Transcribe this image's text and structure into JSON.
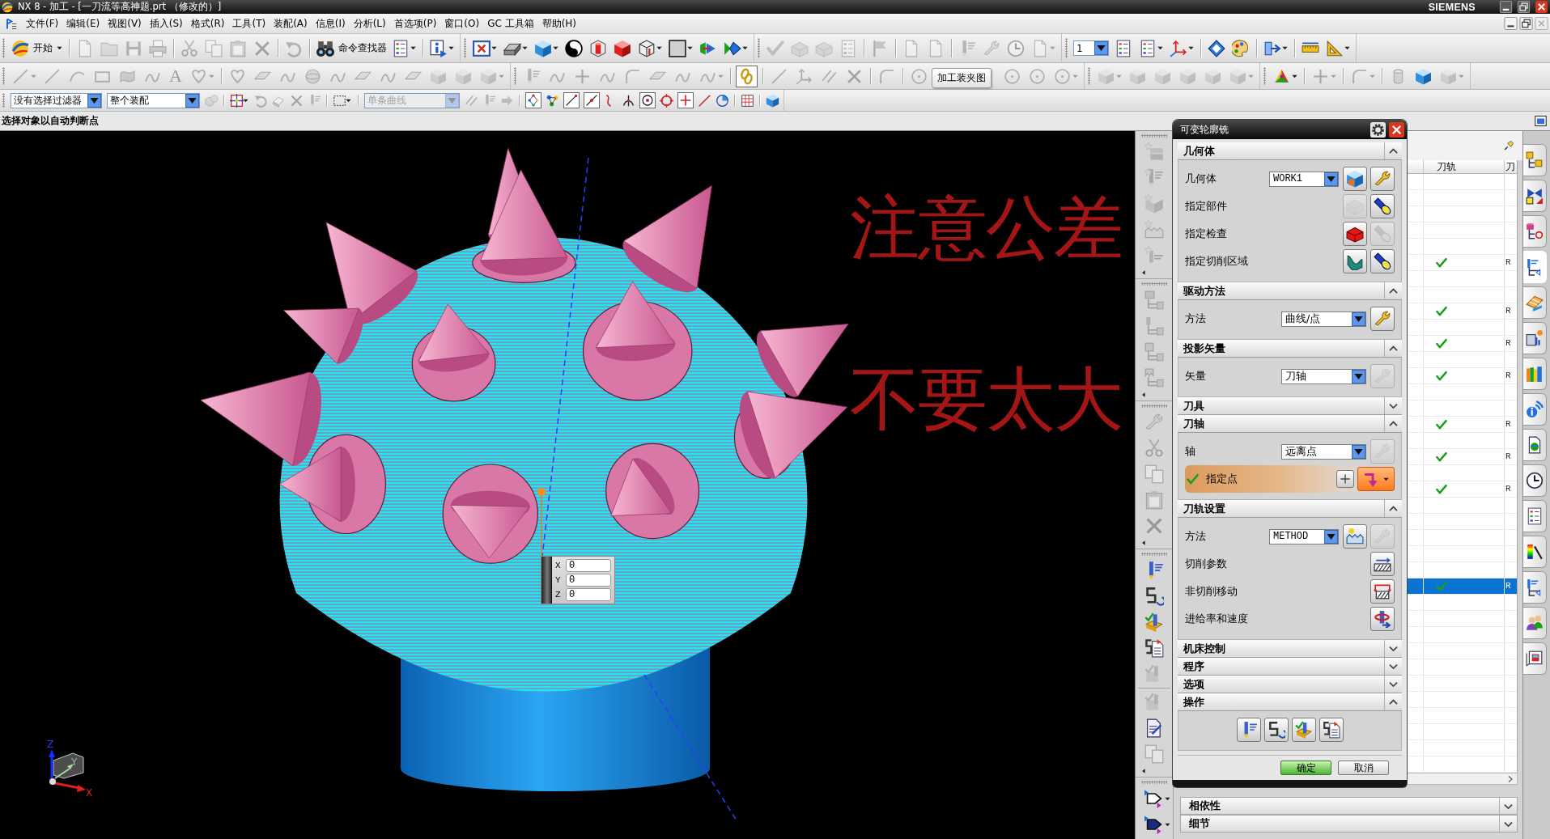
{
  "window": {
    "title": "NX 8 - 加工 - [一刀流等高神题.prt （修改的）]",
    "brand": "SIEMENS"
  },
  "menu": [
    "文件(F)",
    "编辑(E)",
    "视图(V)",
    "插入(S)",
    "格式(R)",
    "工具(T)",
    "装配(A)",
    "信息(I)",
    "分析(L)",
    "首选项(P)",
    "窗口(O)",
    "GC 工具箱",
    "帮助(H)"
  ],
  "toolbar_rows": [
    [
      [
        [
          {
            "kind": "labeled",
            "label": "开始",
            "disabled": false,
            "dropdown": true
          }
        ],
        [
          {
            "kind": "icon",
            "disabled": true,
            "dropdown": false,
            "on": false
          },
          {
            "kind": "icon",
            "disabled": true,
            "dropdown": false,
            "on": false
          },
          {
            "kind": "icon",
            "disabled": true,
            "dropdown": false,
            "on": false
          },
          {
            "kind": "icon",
            "disabled": true,
            "dropdown": false,
            "on": false
          }
        ],
        [
          {
            "kind": "icon",
            "disabled": true,
            "dropdown": false,
            "on": false
          },
          {
            "kind": "icon",
            "disabled": true,
            "dropdown": false,
            "on": false
          },
          {
            "kind": "icon",
            "disabled": true,
            "dropdown": false,
            "on": false
          },
          {
            "kind": "icon",
            "disabled": true,
            "dropdown": false,
            "on": false
          }
        ],
        [
          {
            "kind": "icon",
            "disabled": true,
            "dropdown": false,
            "on": false
          }
        ],
        [
          {
            "kind": "labeled",
            "label": "命令查找器",
            "disabled": false,
            "dropdown": false
          },
          {
            "kind": "icon",
            "disabled": false,
            "dropdown": true,
            "on": false
          }
        ],
        [
          {
            "kind": "icon",
            "disabled": false,
            "dropdown": true,
            "on": false
          }
        ]
      ],
      [
        [
          {
            "kind": "icon",
            "disabled": false,
            "dropdown": true,
            "on": false
          },
          {
            "kind": "icon",
            "disabled": false,
            "dropdown": true,
            "on": false
          },
          {
            "kind": "icon",
            "disabled": false,
            "dropdown": true,
            "on": false
          },
          {
            "kind": "icon",
            "disabled": false,
            "dropdown": false,
            "on": false
          },
          {
            "kind": "icon",
            "disabled": false,
            "dropdown": false,
            "on": false
          },
          {
            "kind": "icon",
            "disabled": false,
            "dropdown": false,
            "on": false
          },
          {
            "kind": "icon",
            "disabled": false,
            "dropdown": true,
            "on": false
          },
          {
            "kind": "icon",
            "disabled": false,
            "dropdown": true,
            "on": false
          },
          {
            "kind": "icon",
            "disabled": false,
            "dropdown": false,
            "on": false
          },
          {
            "kind": "icon",
            "disabled": false,
            "dropdown": true,
            "on": false
          }
        ]
      ],
      [
        [
          {
            "kind": "icon",
            "disabled": true,
            "dropdown": false,
            "on": false
          },
          {
            "kind": "icon",
            "disabled": true,
            "dropdown": false,
            "on": false
          },
          {
            "kind": "icon",
            "disabled": true,
            "dropdown": false,
            "on": false
          },
          {
            "kind": "icon",
            "disabled": true,
            "dropdown": false,
            "on": false
          }
        ],
        [
          {
            "kind": "icon",
            "disabled": true,
            "dropdown": false,
            "on": false
          }
        ],
        [
          {
            "kind": "icon",
            "disabled": true,
            "dropdown": false,
            "on": false
          },
          {
            "kind": "icon",
            "disabled": true,
            "dropdown": false,
            "on": false
          }
        ],
        [
          {
            "kind": "icon",
            "disabled": true,
            "dropdown": false,
            "on": false
          },
          {
            "kind": "icon",
            "disabled": true,
            "dropdown": false,
            "on": false
          },
          {
            "kind": "icon",
            "disabled": true,
            "dropdown": false,
            "on": false
          },
          {
            "kind": "icon",
            "disabled": true,
            "dropdown": true,
            "on": false
          }
        ]
      ],
      [
        [
          {
            "kind": "combo",
            "value": "1",
            "disabled": false
          },
          {
            "kind": "icon",
            "disabled": false,
            "dropdown": false,
            "on": false
          },
          {
            "kind": "icon",
            "disabled": false,
            "dropdown": true,
            "on": false
          },
          {
            "kind": "icon",
            "disabled": false,
            "dropdown": true,
            "on": false
          }
        ],
        [
          {
            "kind": "icon",
            "disabled": false,
            "dropdown": false,
            "on": false
          },
          {
            "kind": "icon",
            "disabled": false,
            "dropdown": false,
            "on": false
          }
        ],
        [
          {
            "kind": "icon",
            "disabled": false,
            "dropdown": true,
            "on": false
          }
        ],
        [
          {
            "kind": "icon",
            "disabled": false,
            "dropdown": false,
            "on": false
          },
          {
            "kind": "icon",
            "disabled": false,
            "dropdown": true,
            "on": false
          }
        ]
      ]
    ],
    [
      [
        [
          {
            "kind": "icon",
            "disabled": true,
            "dropdown": true,
            "on": false
          },
          {
            "kind": "icon",
            "disabled": true,
            "dropdown": false,
            "on": false
          },
          {
            "kind": "icon",
            "disabled": true,
            "dropdown": false,
            "on": false
          },
          {
            "kind": "icon",
            "disabled": true,
            "dropdown": false,
            "on": false
          },
          {
            "kind": "icon",
            "disabled": true,
            "dropdown": false,
            "on": false
          },
          {
            "kind": "icon",
            "disabled": true,
            "dropdown": false,
            "on": false
          },
          {
            "kind": "glyph",
            "text": "A",
            "disabled": true,
            "dropdown": false
          },
          {
            "kind": "icon",
            "disabled": true,
            "dropdown": true,
            "on": false
          }
        ],
        [
          {
            "kind": "icon",
            "disabled": true,
            "dropdown": false,
            "on": false
          },
          {
            "kind": "icon",
            "disabled": true,
            "dropdown": false,
            "on": false
          },
          {
            "kind": "icon",
            "disabled": true,
            "dropdown": false,
            "on": false
          },
          {
            "kind": "icon",
            "disabled": true,
            "dropdown": false,
            "on": false
          },
          {
            "kind": "icon",
            "disabled": true,
            "dropdown": false,
            "on": false
          },
          {
            "kind": "icon",
            "disabled": true,
            "dropdown": false,
            "on": false
          },
          {
            "kind": "icon",
            "disabled": true,
            "dropdown": false,
            "on": false
          },
          {
            "kind": "icon",
            "disabled": true,
            "dropdown": false,
            "on": false
          },
          {
            "kind": "icon",
            "disabled": true,
            "dropdown": false,
            "on": false
          },
          {
            "kind": "icon",
            "disabled": true,
            "dropdown": false,
            "on": false
          },
          {
            "kind": "icon",
            "disabled": true,
            "dropdown": true,
            "on": false
          }
        ]
      ],
      [
        [
          {
            "kind": "icon",
            "disabled": true,
            "dropdown": false,
            "on": false
          },
          {
            "kind": "icon",
            "disabled": true,
            "dropdown": false,
            "on": false
          },
          {
            "kind": "icon",
            "disabled": true,
            "dropdown": false,
            "on": false
          },
          {
            "kind": "icon",
            "disabled": true,
            "dropdown": false,
            "on": false
          },
          {
            "kind": "icon",
            "disabled": true,
            "dropdown": false,
            "on": false
          },
          {
            "kind": "icon",
            "disabled": true,
            "dropdown": false,
            "on": false
          },
          {
            "kind": "icon",
            "disabled": true,
            "dropdown": false,
            "on": false
          },
          {
            "kind": "icon",
            "disabled": true,
            "dropdown": true,
            "on": false
          }
        ],
        [
          {
            "kind": "icon",
            "disabled": false,
            "dropdown": false,
            "on": true
          }
        ],
        [
          {
            "kind": "icon",
            "disabled": true,
            "dropdown": false,
            "on": false
          },
          {
            "kind": "icon",
            "disabled": true,
            "dropdown": false,
            "on": false
          },
          {
            "kind": "icon",
            "disabled": true,
            "dropdown": false,
            "on": false
          },
          {
            "kind": "icon",
            "disabled": true,
            "dropdown": false,
            "on": false
          }
        ],
        [
          {
            "kind": "icon",
            "disabled": true,
            "dropdown": false,
            "on": false
          }
        ],
        [
          {
            "kind": "icon",
            "disabled": true,
            "dropdown": false,
            "on": false
          },
          {
            "kind": "icon",
            "disabled": true,
            "dropdown": false,
            "on": false
          },
          {
            "kind": "icon",
            "disabled": true,
            "dropdown": false,
            "on": false
          },
          {
            "kind": "icon",
            "disabled": true,
            "dropdown": true,
            "on": false
          }
        ]
      ],
      [
        [
          {
            "kind": "icon",
            "disabled": true,
            "dropdown": true,
            "on": false
          },
          {
            "kind": "icon",
            "disabled": true,
            "dropdown": false,
            "on": false
          },
          {
            "kind": "icon",
            "disabled": true,
            "dropdown": false,
            "on": false
          },
          {
            "kind": "icon",
            "disabled": true,
            "dropdown": false,
            "on": false
          },
          {
            "kind": "icon",
            "disabled": true,
            "dropdown": false,
            "on": false
          },
          {
            "kind": "icon",
            "disabled": true,
            "dropdown": true,
            "on": false
          }
        ]
      ],
      [
        [
          {
            "kind": "icon",
            "disabled": false,
            "dropdown": true,
            "on": false
          }
        ],
        [
          {
            "kind": "icon",
            "disabled": true,
            "dropdown": true,
            "on": false
          }
        ],
        [
          {
            "kind": "icon",
            "disabled": true,
            "dropdown": true,
            "on": false
          }
        ],
        [
          {
            "kind": "icon",
            "disabled": true,
            "dropdown": false,
            "on": false
          },
          {
            "kind": "icon",
            "disabled": false,
            "dropdown": false,
            "on": false
          },
          {
            "kind": "icon",
            "disabled": true,
            "dropdown": true,
            "on": false
          }
        ]
      ]
    ],
    [
      [
        [
          {
            "kind": "combo",
            "value": "没有选择过滤器",
            "disabled": false
          },
          {
            "kind": "combo",
            "value": "整个装配",
            "disabled": false
          },
          {
            "kind": "icon",
            "disabled": true,
            "dropdown": false,
            "on": false
          }
        ],
        [
          {
            "kind": "icon",
            "disabled": false,
            "dropdown": true,
            "on": false
          },
          {
            "kind": "icon",
            "disabled": true,
            "dropdown": false,
            "on": false
          },
          {
            "kind": "icon",
            "disabled": true,
            "dropdown": false,
            "on": false
          },
          {
            "kind": "icon",
            "disabled": true,
            "dropdown": false,
            "on": false
          },
          {
            "kind": "icon",
            "disabled": true,
            "dropdown": false,
            "on": false
          }
        ],
        [
          {
            "kind": "icon",
            "disabled": false,
            "dropdown": true,
            "on": false
          }
        ],
        [
          {
            "kind": "combo",
            "value": "单条曲线",
            "disabled": true
          },
          {
            "kind": "icon",
            "disabled": true,
            "dropdown": false,
            "on": false
          },
          {
            "kind": "icon",
            "disabled": true,
            "dropdown": false,
            "on": false
          },
          {
            "kind": "icon",
            "disabled": true,
            "dropdown": false,
            "on": false
          }
        ],
        [
          {
            "kind": "icon",
            "disabled": false,
            "dropdown": false,
            "on": true
          },
          {
            "kind": "icon",
            "disabled": false,
            "dropdown": false,
            "on": false
          },
          {
            "kind": "icon",
            "disabled": false,
            "dropdown": false,
            "on": true
          },
          {
            "kind": "icon",
            "disabled": false,
            "dropdown": false,
            "on": true
          },
          {
            "kind": "icon",
            "disabled": false,
            "dropdown": false,
            "on": false
          },
          {
            "kind": "icon",
            "disabled": false,
            "dropdown": false,
            "on": false
          },
          {
            "kind": "icon",
            "disabled": false,
            "dropdown": false,
            "on": true
          },
          {
            "kind": "icon",
            "disabled": false,
            "dropdown": false,
            "on": false
          },
          {
            "kind": "icon",
            "disabled": false,
            "dropdown": false,
            "on": true
          },
          {
            "kind": "icon",
            "disabled": false,
            "dropdown": false,
            "on": false
          },
          {
            "kind": "icon",
            "disabled": false,
            "dropdown": false,
            "on": false
          }
        ],
        [
          {
            "kind": "icon",
            "disabled": false,
            "dropdown": false,
            "on": false
          }
        ],
        [
          {
            "kind": "icon",
            "disabled": false,
            "dropdown": false,
            "on": false
          }
        ]
      ]
    ]
  ],
  "tooltip": "加工装夹图",
  "cue_line": "选择对象以自动判断点",
  "viewport": {
    "annotation": [
      "注意公差",
      "不要太大"
    ],
    "point_input": [
      {
        "label": "X",
        "value": "0"
      },
      {
        "label": "Y",
        "value": "0"
      },
      {
        "label": "Z",
        "value": "0"
      }
    ],
    "triad_labels": [
      "Z",
      "Y",
      "X"
    ]
  },
  "operation_toolbar": [
    [
      [
        {
          "disabled": true,
          "dropdown": false
        },
        {
          "disabled": true,
          "dropdown": false
        },
        {
          "disabled": true,
          "dropdown": false
        },
        {
          "disabled": true,
          "dropdown": false
        },
        {
          "disabled": true,
          "dropdown": false
        }
      ]
    ],
    [
      [
        {
          "disabled": true,
          "dropdown": false
        },
        {
          "disabled": true,
          "dropdown": false
        },
        {
          "disabled": true,
          "dropdown": false
        },
        {
          "disabled": true,
          "dropdown": false
        }
      ]
    ],
    [
      [
        {
          "disabled": true,
          "dropdown": false
        },
        {
          "disabled": true,
          "dropdown": false
        },
        {
          "disabled": true,
          "dropdown": false
        },
        {
          "disabled": true,
          "dropdown": false
        },
        {
          "disabled": true,
          "dropdown": false
        }
      ]
    ],
    [
      [
        {
          "disabled": false,
          "dropdown": false
        },
        {
          "disabled": false,
          "dropdown": false
        },
        {
          "disabled": false,
          "dropdown": false
        },
        {
          "disabled": false,
          "dropdown": false
        },
        {
          "disabled": true,
          "dropdown": false
        }
      ],
      [
        {
          "disabled": true,
          "dropdown": false
        },
        {
          "disabled": false,
          "dropdown": false
        },
        {
          "disabled": true,
          "dropdown": false
        }
      ]
    ],
    [
      [
        {
          "disabled": false,
          "dropdown": true
        },
        {
          "disabled": false,
          "dropdown": true
        }
      ]
    ]
  ],
  "dialog": {
    "title": "可变轮廓铣",
    "sections": [
      {
        "title": "几何体",
        "expanded": true,
        "rows": [
          {
            "kind": "combo",
            "label": "几何体",
            "value": "WORK1",
            "buttons": [
              {
                "disabled": false
              },
              {
                "disabled": false
              }
            ]
          },
          {
            "kind": "select",
            "label": "指定部件",
            "buttons": [
              {
                "disabled": true
              },
              {
                "disabled": false
              }
            ]
          },
          {
            "kind": "select",
            "label": "指定检查",
            "buttons": [
              {
                "disabled": false
              },
              {
                "disabled": true
              }
            ]
          },
          {
            "kind": "select",
            "label": "指定切削区域",
            "buttons": [
              {
                "disabled": false
              },
              {
                "disabled": false
              }
            ]
          }
        ]
      },
      {
        "title": "驱动方法",
        "expanded": true,
        "rows": [
          {
            "kind": "combo",
            "label": "方法",
            "value": "曲线/点",
            "buttons": [
              {
                "disabled": false
              }
            ]
          }
        ]
      },
      {
        "title": "投影矢量",
        "expanded": true,
        "rows": [
          {
            "kind": "combo",
            "label": "矢量",
            "value": "刀轴",
            "buttons": [
              {
                "disabled": true
              }
            ]
          }
        ]
      },
      {
        "title": "刀具",
        "expanded": false
      },
      {
        "title": "刀轴",
        "expanded": true,
        "rows": [
          {
            "kind": "combo",
            "label": "轴",
            "value": "远离点",
            "buttons": [
              {
                "disabled": true
              }
            ]
          },
          {
            "kind": "point",
            "label": "指定点",
            "checked": true,
            "active": true,
            "buttons": [
              {
                "disabled": false
              },
              {
                "disabled": false
              }
            ]
          }
        ]
      },
      {
        "title": "刀轨设置",
        "expanded": true,
        "rows": [
          {
            "kind": "combo",
            "label": "方法",
            "value": "METHOD",
            "buttons": [
              {
                "disabled": false
              },
              {
                "disabled": true
              }
            ]
          },
          {
            "kind": "action",
            "label": "切削参数",
            "buttons": [
              {
                "disabled": false
              }
            ]
          },
          {
            "kind": "action",
            "label": "非切削移动",
            "buttons": [
              {
                "disabled": false
              }
            ]
          },
          {
            "kind": "action",
            "label": "进给率和速度",
            "buttons": [
              {
                "disabled": false
              }
            ]
          }
        ]
      },
      {
        "title": "机床控制",
        "expanded": false
      },
      {
        "title": "程序",
        "expanded": false
      },
      {
        "title": "选项",
        "expanded": false
      },
      {
        "title": "操作",
        "expanded": true,
        "rows": [
          {
            "kind": "toolbar",
            "buttons": [
              {
                "disabled": false
              },
              {
                "disabled": false
              },
              {
                "disabled": false
              },
              {
                "disabled": false
              }
            ]
          }
        ]
      }
    ],
    "footer": [
      {
        "label": "确定",
        "default": true
      },
      {
        "label": "取消",
        "default": false
      }
    ]
  },
  "navigator": {
    "columns": [
      "刀轨",
      "刀"
    ],
    "rows": [
      {
        "toolpath_ok": false,
        "selected": false
      },
      {
        "toolpath_ok": false,
        "selected": false
      },
      {
        "toolpath_ok": false,
        "selected": false
      },
      {
        "toolpath_ok": false,
        "selected": false
      },
      {
        "toolpath_ok": false,
        "selected": false
      },
      {
        "toolpath_ok": true,
        "column_3": "R",
        "selected": false
      },
      {
        "toolpath_ok": false,
        "selected": false
      },
      {
        "toolpath_ok": false,
        "selected": false
      },
      {
        "toolpath_ok": true,
        "column_3": "R",
        "selected": false
      },
      {
        "toolpath_ok": false,
        "selected": false
      },
      {
        "toolpath_ok": true,
        "column_3": "R",
        "selected": false
      },
      {
        "toolpath_ok": false,
        "selected": false
      },
      {
        "toolpath_ok": true,
        "column_3": "R",
        "selected": false
      },
      {
        "toolpath_ok": false,
        "selected": false
      },
      {
        "toolpath_ok": false,
        "selected": false
      },
      {
        "toolpath_ok": true,
        "column_3": "R",
        "selected": false
      },
      {
        "toolpath_ok": false,
        "selected": false
      },
      {
        "toolpath_ok": true,
        "column_3": "R",
        "selected": false
      },
      {
        "toolpath_ok": false,
        "selected": false
      },
      {
        "toolpath_ok": true,
        "column_3": "R",
        "selected": false
      },
      {
        "toolpath_ok": false,
        "selected": false
      },
      {
        "toolpath_ok": false,
        "selected": false
      },
      {
        "toolpath_ok": false,
        "selected": false
      },
      {
        "toolpath_ok": false,
        "selected": false
      },
      {
        "toolpath_ok": false,
        "selected": false
      },
      {
        "toolpath_ok": true,
        "column_3": "R",
        "selected": true
      },
      {
        "toolpath_ok": false,
        "selected": false
      },
      {
        "toolpath_ok": false,
        "selected": false
      },
      {
        "toolpath_ok": false,
        "selected": false
      },
      {
        "toolpath_ok": false,
        "selected": false
      },
      {
        "toolpath_ok": false,
        "selected": false
      },
      {
        "toolpath_ok": false,
        "selected": false
      },
      {
        "toolpath_ok": false,
        "selected": false
      },
      {
        "toolpath_ok": false,
        "selected": false
      },
      {
        "toolpath_ok": false,
        "selected": false
      },
      {
        "toolpath_ok": false,
        "selected": false
      },
      {
        "toolpath_ok": false,
        "selected": false
      }
    ],
    "panels": [
      {
        "title": "相依性",
        "expanded": false
      },
      {
        "title": "细节",
        "expanded": false
      }
    ]
  },
  "resource_bar": [
    {
      "selected": false
    },
    {
      "selected": false
    },
    {
      "selected": false
    },
    {
      "selected": true
    },
    {
      "selected": false
    },
    {
      "selected": false
    },
    {
      "selected": false
    },
    {
      "selected": false
    },
    {
      "selected": false
    },
    {
      "selected": false
    },
    {
      "selected": false
    },
    {
      "selected": false
    },
    {
      "selected": false
    },
    {
      "selected": false
    },
    {
      "selected": false
    }
  ]
}
